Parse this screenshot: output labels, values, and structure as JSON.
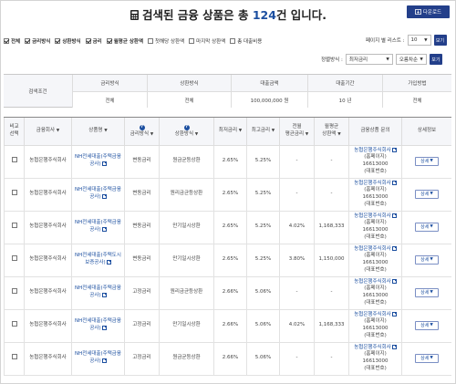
{
  "header": {
    "title_prefix": "검색된 금융 상품은 총 ",
    "count": "124",
    "title_suffix": "건 입니다.",
    "download_label": "다운로드"
  },
  "filters": [
    {
      "label": "전체",
      "checked": true,
      "bold": true
    },
    {
      "label": "금리방식",
      "checked": true,
      "bold": true
    },
    {
      "label": "상환방식",
      "checked": true,
      "bold": true
    },
    {
      "label": "금리",
      "checked": true,
      "bold": true
    },
    {
      "label": "월평균 상환액",
      "checked": true,
      "bold": true
    },
    {
      "label": "첫해당 상환액",
      "checked": false,
      "bold": false
    },
    {
      "label": "마지막 상환액",
      "checked": false,
      "bold": false
    },
    {
      "label": "총 대출비용",
      "checked": false,
      "bold": false
    }
  ],
  "per_page": {
    "label": "페이지 별 리스트 :",
    "value": "10",
    "button": "보기"
  },
  "sort": {
    "label": "정렬방식 :",
    "value1": "최저금리",
    "value2": "오름차순",
    "button": "보기"
  },
  "condition": {
    "label": "검색조건",
    "headers": [
      "금리방식",
      "상환방식",
      "대출금액",
      "대출기간",
      "가입방법"
    ],
    "values": [
      "전체",
      "전체",
      "100,000,000 원",
      "10 년",
      "전체"
    ]
  },
  "table": {
    "headers": {
      "compare": "비교\n선택",
      "company": "금융회사",
      "product": "상품명",
      "rate_type": "금리방식",
      "repay_type": "상환방식",
      "min_rate": "최저금리",
      "max_rate": "최고금리",
      "avg_rate": "전월\n평균금리",
      "monthly": "월평균\n상환액",
      "inquiry": "금융상품 문의",
      "detail": "상세정보"
    },
    "detail_label": "상세",
    "rows": [
      {
        "company": "농협은행주식회사",
        "product": "NH전세대출(주택금융공사)",
        "rate_type": "변동금리",
        "repay_type": "원금균등상환",
        "min": "2.65%",
        "max": "5.25%",
        "avg": "-",
        "monthly": "-",
        "inq1": "농협은행주식회사",
        "inq2": "(홈페이지)",
        "inq3": "16613000",
        "inq4": "(대표번호)"
      },
      {
        "company": "농협은행주식회사",
        "product": "NH전세대출(주택금융공사)",
        "rate_type": "변동금리",
        "repay_type": "원리금균등상환",
        "min": "2.65%",
        "max": "5.25%",
        "avg": "-",
        "monthly": "-",
        "inq1": "농협은행주식회사",
        "inq2": "(홈페이지)",
        "inq3": "16613000",
        "inq4": "(대표번호)"
      },
      {
        "company": "농협은행주식회사",
        "product": "NH전세대출(주택금융공사)",
        "rate_type": "변동금리",
        "repay_type": "만기일시상환",
        "min": "2.65%",
        "max": "5.25%",
        "avg": "4.02%",
        "monthly": "1,168,333",
        "inq1": "농협은행주식회사",
        "inq2": "(홈페이지)",
        "inq3": "16613000",
        "inq4": "(대표번호)"
      },
      {
        "company": "농협은행주식회사",
        "product": "NH전세대출(주택도시보증공사)",
        "rate_type": "변동금리",
        "repay_type": "만기일시상환",
        "min": "2.65%",
        "max": "5.25%",
        "avg": "3.80%",
        "monthly": "1,150,000",
        "inq1": "농협은행주식회사",
        "inq2": "(홈페이지)",
        "inq3": "16613000",
        "inq4": "(대표번호)"
      },
      {
        "company": "농협은행주식회사",
        "product": "NH전세대출(주택금융공사)",
        "rate_type": "고정금리",
        "repay_type": "원리금균등상환",
        "min": "2.66%",
        "max": "5.06%",
        "avg": "-",
        "monthly": "-",
        "inq1": "농협은행주식회사",
        "inq2": "(홈페이지)",
        "inq3": "16613000",
        "inq4": "(대표번호)"
      },
      {
        "company": "농협은행주식회사",
        "product": "NH전세대출(주택금융공사)",
        "rate_type": "고정금리",
        "repay_type": "만기일시상환",
        "min": "2.66%",
        "max": "5.06%",
        "avg": "4.02%",
        "monthly": "1,168,333",
        "inq1": "농협은행주식회사",
        "inq2": "(홈페이지)",
        "inq3": "16613000",
        "inq4": "(대표번호)"
      },
      {
        "company": "농협은행주식회사",
        "product": "NH전세대출(주택금융공사)",
        "rate_type": "고정금리",
        "repay_type": "원금균등상환",
        "min": "2.66%",
        "max": "5.06%",
        "avg": "-",
        "monthly": "-",
        "inq1": "농협은행주식회사",
        "inq2": "(홈페이지)",
        "inq3": "16613000",
        "inq4": "(대표번호)"
      }
    ]
  },
  "colors": {
    "accent": "#233f8a",
    "link": "#1c4fa0",
    "header_bg": "#f5f6f9"
  },
  "icons": {
    "title": "calculator-icon",
    "download": "download-icon",
    "help": "question-icon",
    "external": "external-link-icon",
    "dropdown": "chevron-down-icon"
  }
}
